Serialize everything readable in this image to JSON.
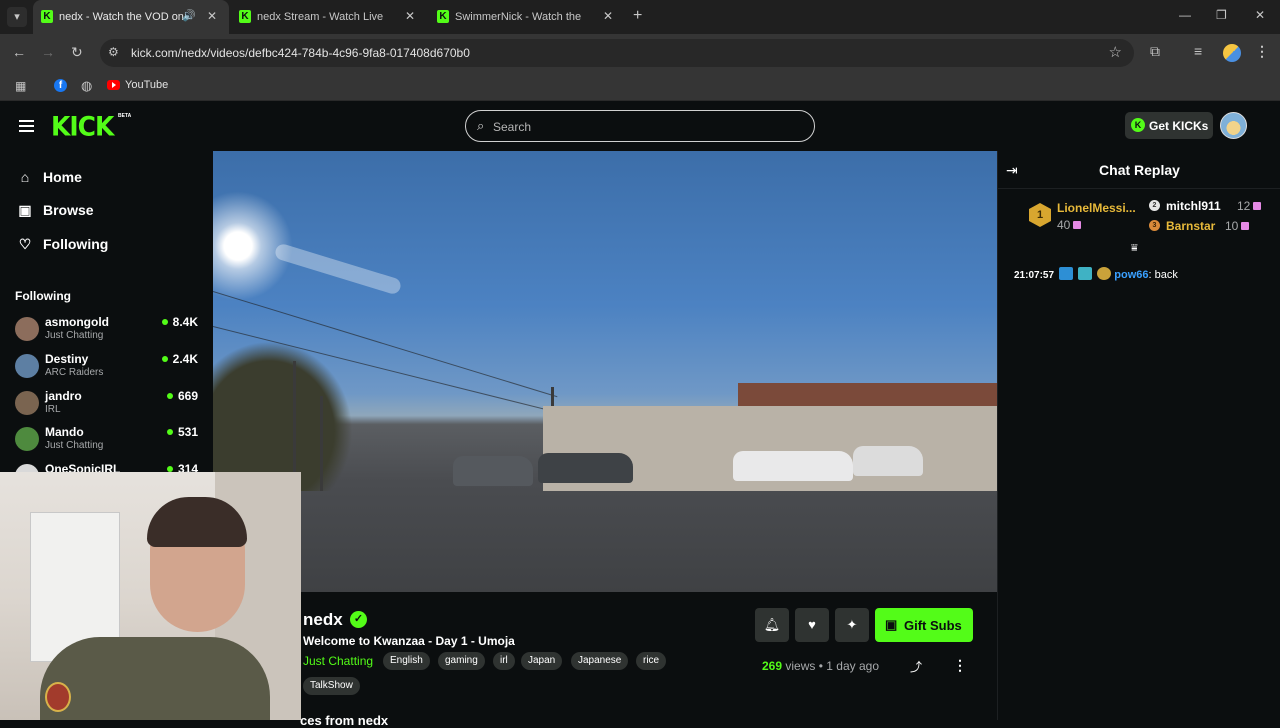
{
  "browser": {
    "tabs": [
      {
        "title": "nedx - Watch the VOD on Kick",
        "icon": "kick-favicon",
        "active": true,
        "audio": true
      },
      {
        "title": "nedx Stream - Watch Live on Kick",
        "icon": "kick-favicon",
        "active": false
      },
      {
        "title": "SwimmerNick - Watch the VOD",
        "icon": "kick-favicon",
        "active": false
      }
    ],
    "url": "kick.com/nedx/videos/defbc424-784b-4c96-9fa8-017408d670b0",
    "bookmarks": [
      {
        "label": "",
        "icon": "facebook-icon"
      },
      {
        "label": "",
        "icon": "globe-icon"
      },
      {
        "label": "YouTube",
        "icon": "youtube-icon"
      }
    ]
  },
  "header": {
    "logo_text": "KICK",
    "logo_badge": "BETA",
    "search_placeholder": "Search",
    "get_kicks_label": "Get KICKs"
  },
  "sidebar": {
    "nav": [
      {
        "label": "Home",
        "icon": "home-icon"
      },
      {
        "label": "Browse",
        "icon": "browse-icon"
      },
      {
        "label": "Following",
        "icon": "heart-icon"
      }
    ],
    "following_heading": "Following",
    "channels": [
      {
        "name": "asmongold",
        "category": "Just Chatting",
        "viewers": "8.4K",
        "avatar_color": "#8c6d5c"
      },
      {
        "name": "Destiny",
        "category": "ARC Raiders",
        "viewers": "2.4K",
        "avatar_color": "#5d7fa3"
      },
      {
        "name": "jandro",
        "category": "IRL",
        "viewers": "669",
        "avatar_color": "#7a6450"
      },
      {
        "name": "Mando",
        "category": "Just Chatting",
        "viewers": "531",
        "avatar_color": "#4e8a3e"
      },
      {
        "name": "OneSonicIRL",
        "category": "",
        "viewers": "314",
        "avatar_color": "#d9d9d9"
      }
    ]
  },
  "stream": {
    "streamer": "nedx",
    "title": "Welcome to Kwanzaa - Day 1 - Umoja",
    "category": "Just Chatting",
    "tags": [
      "English",
      "gaming",
      "irl",
      "Japan",
      "Japanese",
      "rice",
      "TalkShow"
    ],
    "views_count": "269",
    "views_label": "views",
    "separator": "•",
    "age": "1 day ago",
    "gift_label": "Gift Subs",
    "more_heading": "ces from nedx"
  },
  "chat": {
    "title": "Chat Replay",
    "leaderboard": [
      {
        "rank": "1",
        "name": "LionelMessi...",
        "count": "40",
        "color": "#e7b93a"
      },
      {
        "rank": "2",
        "name": "mitchl911",
        "count": "12",
        "color": "#ffffff"
      },
      {
        "rank": "3",
        "name": "Barnstar",
        "count": "10",
        "color": "#e7b93a"
      }
    ],
    "messages": [
      {
        "time": "21:07:57",
        "user": "pow66",
        "text": ": back"
      }
    ]
  },
  "colors": {
    "brand": "#53fc18",
    "background": "#0b0e0f",
    "chip": "#2f3331"
  }
}
